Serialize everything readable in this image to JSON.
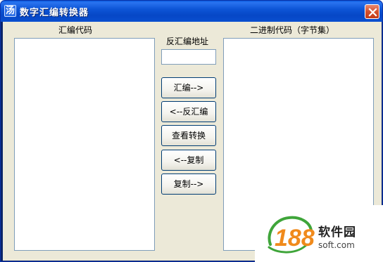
{
  "window": {
    "title": "数字汇编转换器",
    "app_icon_glyph": "汤",
    "close_icon": "close-icon"
  },
  "left_panel": {
    "label": "汇编代码"
  },
  "middle_panel": {
    "address_label": "反汇编地址",
    "address_value": "",
    "buttons": [
      {
        "label": "汇编-->"
      },
      {
        "label": "<--反汇编"
      },
      {
        "label": "查看转换"
      },
      {
        "label": "<--复制"
      },
      {
        "label": "复制-->"
      }
    ]
  },
  "right_panel": {
    "label": "二进制代码（字节集）"
  },
  "watermark": {
    "logo_text": "188",
    "name": "软件园",
    "domain": "soft.com"
  },
  "colors": {
    "titlebar": "#0a4fd0",
    "client_bg": "#ece9d8",
    "close_button": "#d5502c",
    "input_border": "#7f9db9",
    "logo_orange": "#f08a1c",
    "logo_green": "#3fa53a"
  }
}
